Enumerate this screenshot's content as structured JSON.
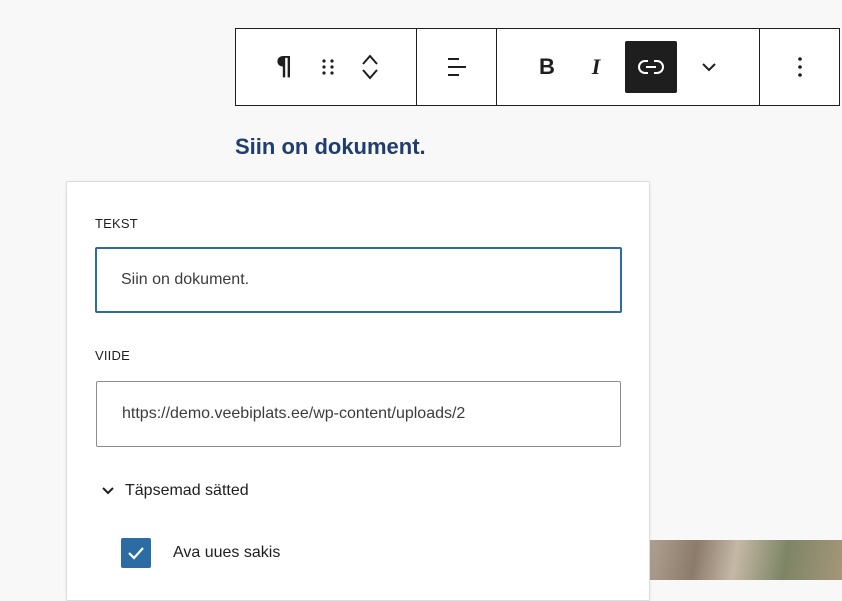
{
  "toolbar": {
    "paragraph_icon": "¶",
    "bold_label": "B",
    "italic_label": "I",
    "active_color": "#1e1e1e"
  },
  "heading": {
    "text": "Siin on dokument.",
    "color": "#1f3d6e"
  },
  "link_popover": {
    "text_field": {
      "label": "TEKST",
      "value": "Siin on dokument."
    },
    "url_field": {
      "label": "VIIDE",
      "value": "https://demo.veebiplats.ee/wp-content/uploads/2"
    },
    "advanced": {
      "label": "Täpsemad sätted",
      "expanded": true
    },
    "open_new_tab": {
      "label": "Ava uues sakis",
      "checked": true
    },
    "accent_color": "#2b6ca5"
  },
  "icons": [
    "paragraph-icon",
    "drag-handle-icon",
    "move-up-icon",
    "move-down-icon",
    "align-icon",
    "link-icon",
    "chevron-down-icon",
    "more-vertical-icon",
    "checkmark-icon"
  ]
}
